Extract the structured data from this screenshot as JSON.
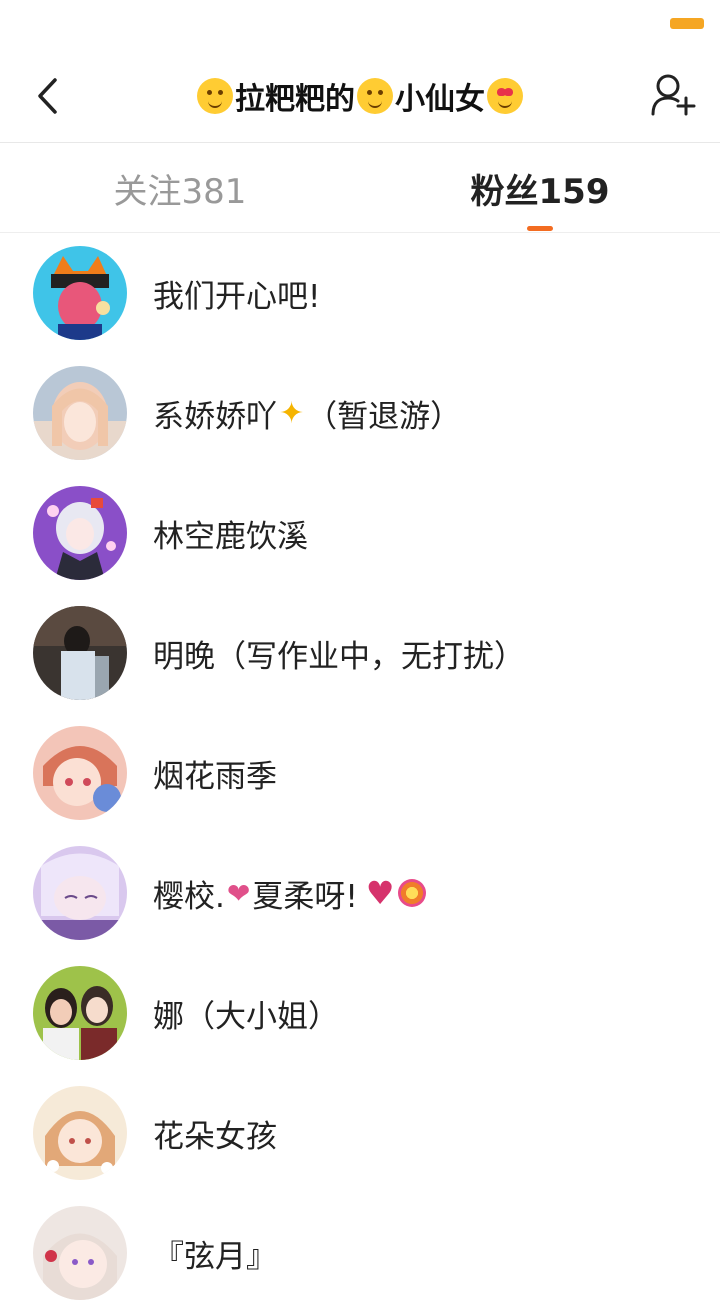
{
  "header": {
    "title_part1": "拉粑粑的",
    "title_part2": "小仙女"
  },
  "tabs": [
    {
      "label": "关注381"
    },
    {
      "label": "粉丝159"
    }
  ],
  "fans": [
    {
      "name": "我们开心吧!"
    },
    {
      "name_a": "系娇娇吖",
      "name_b": "（暂退游）"
    },
    {
      "name": "林空鹿饮溪"
    },
    {
      "name": "明晚（写作业中，无打扰）"
    },
    {
      "name": "烟花雨季"
    },
    {
      "name_a": "樱校.",
      "name_b": "夏柔呀!"
    },
    {
      "name": "娜（大小姐）"
    },
    {
      "name": "花朵女孩"
    },
    {
      "name": "『弦月』"
    }
  ],
  "colors": {
    "accent": "#f36c21",
    "battery": "#f5a623"
  },
  "icons": {
    "back": "chevron-left-icon",
    "add_friend": "add-user-icon"
  }
}
